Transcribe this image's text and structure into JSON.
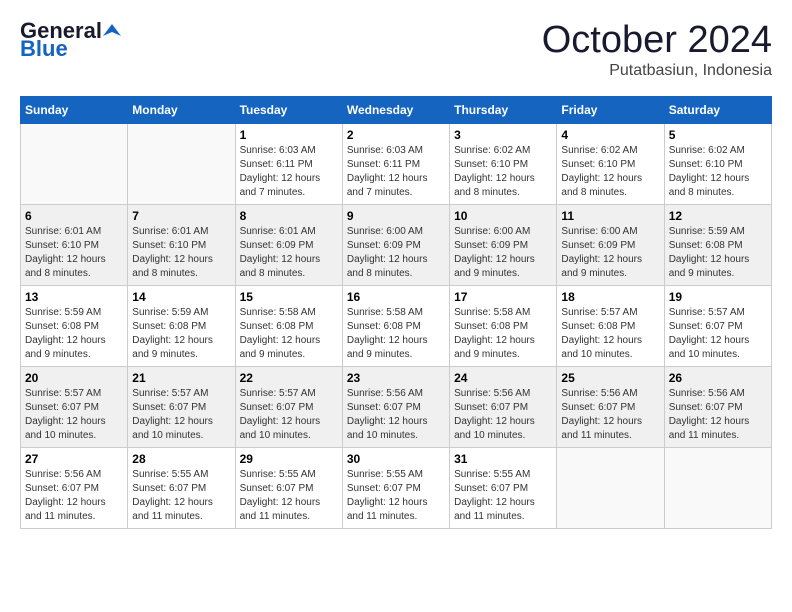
{
  "header": {
    "logo_general": "General",
    "logo_blue": "Blue",
    "month_title": "October 2024",
    "location": "Putatbasiun, Indonesia"
  },
  "weekdays": [
    "Sunday",
    "Monday",
    "Tuesday",
    "Wednesday",
    "Thursday",
    "Friday",
    "Saturday"
  ],
  "weeks": [
    [
      {
        "day": "",
        "info": ""
      },
      {
        "day": "",
        "info": ""
      },
      {
        "day": "1",
        "info": "Sunrise: 6:03 AM\nSunset: 6:11 PM\nDaylight: 12 hours and 7 minutes."
      },
      {
        "day": "2",
        "info": "Sunrise: 6:03 AM\nSunset: 6:11 PM\nDaylight: 12 hours and 7 minutes."
      },
      {
        "day": "3",
        "info": "Sunrise: 6:02 AM\nSunset: 6:10 PM\nDaylight: 12 hours and 8 minutes."
      },
      {
        "day": "4",
        "info": "Sunrise: 6:02 AM\nSunset: 6:10 PM\nDaylight: 12 hours and 8 minutes."
      },
      {
        "day": "5",
        "info": "Sunrise: 6:02 AM\nSunset: 6:10 PM\nDaylight: 12 hours and 8 minutes."
      }
    ],
    [
      {
        "day": "6",
        "info": "Sunrise: 6:01 AM\nSunset: 6:10 PM\nDaylight: 12 hours and 8 minutes."
      },
      {
        "day": "7",
        "info": "Sunrise: 6:01 AM\nSunset: 6:10 PM\nDaylight: 12 hours and 8 minutes."
      },
      {
        "day": "8",
        "info": "Sunrise: 6:01 AM\nSunset: 6:09 PM\nDaylight: 12 hours and 8 minutes."
      },
      {
        "day": "9",
        "info": "Sunrise: 6:00 AM\nSunset: 6:09 PM\nDaylight: 12 hours and 8 minutes."
      },
      {
        "day": "10",
        "info": "Sunrise: 6:00 AM\nSunset: 6:09 PM\nDaylight: 12 hours and 9 minutes."
      },
      {
        "day": "11",
        "info": "Sunrise: 6:00 AM\nSunset: 6:09 PM\nDaylight: 12 hours and 9 minutes."
      },
      {
        "day": "12",
        "info": "Sunrise: 5:59 AM\nSunset: 6:08 PM\nDaylight: 12 hours and 9 minutes."
      }
    ],
    [
      {
        "day": "13",
        "info": "Sunrise: 5:59 AM\nSunset: 6:08 PM\nDaylight: 12 hours and 9 minutes."
      },
      {
        "day": "14",
        "info": "Sunrise: 5:59 AM\nSunset: 6:08 PM\nDaylight: 12 hours and 9 minutes."
      },
      {
        "day": "15",
        "info": "Sunrise: 5:58 AM\nSunset: 6:08 PM\nDaylight: 12 hours and 9 minutes."
      },
      {
        "day": "16",
        "info": "Sunrise: 5:58 AM\nSunset: 6:08 PM\nDaylight: 12 hours and 9 minutes."
      },
      {
        "day": "17",
        "info": "Sunrise: 5:58 AM\nSunset: 6:08 PM\nDaylight: 12 hours and 9 minutes."
      },
      {
        "day": "18",
        "info": "Sunrise: 5:57 AM\nSunset: 6:08 PM\nDaylight: 12 hours and 10 minutes."
      },
      {
        "day": "19",
        "info": "Sunrise: 5:57 AM\nSunset: 6:07 PM\nDaylight: 12 hours and 10 minutes."
      }
    ],
    [
      {
        "day": "20",
        "info": "Sunrise: 5:57 AM\nSunset: 6:07 PM\nDaylight: 12 hours and 10 minutes."
      },
      {
        "day": "21",
        "info": "Sunrise: 5:57 AM\nSunset: 6:07 PM\nDaylight: 12 hours and 10 minutes."
      },
      {
        "day": "22",
        "info": "Sunrise: 5:57 AM\nSunset: 6:07 PM\nDaylight: 12 hours and 10 minutes."
      },
      {
        "day": "23",
        "info": "Sunrise: 5:56 AM\nSunset: 6:07 PM\nDaylight: 12 hours and 10 minutes."
      },
      {
        "day": "24",
        "info": "Sunrise: 5:56 AM\nSunset: 6:07 PM\nDaylight: 12 hours and 10 minutes."
      },
      {
        "day": "25",
        "info": "Sunrise: 5:56 AM\nSunset: 6:07 PM\nDaylight: 12 hours and 11 minutes."
      },
      {
        "day": "26",
        "info": "Sunrise: 5:56 AM\nSunset: 6:07 PM\nDaylight: 12 hours and 11 minutes."
      }
    ],
    [
      {
        "day": "27",
        "info": "Sunrise: 5:56 AM\nSunset: 6:07 PM\nDaylight: 12 hours and 11 minutes."
      },
      {
        "day": "28",
        "info": "Sunrise: 5:55 AM\nSunset: 6:07 PM\nDaylight: 12 hours and 11 minutes."
      },
      {
        "day": "29",
        "info": "Sunrise: 5:55 AM\nSunset: 6:07 PM\nDaylight: 12 hours and 11 minutes."
      },
      {
        "day": "30",
        "info": "Sunrise: 5:55 AM\nSunset: 6:07 PM\nDaylight: 12 hours and 11 minutes."
      },
      {
        "day": "31",
        "info": "Sunrise: 5:55 AM\nSunset: 6:07 PM\nDaylight: 12 hours and 11 minutes."
      },
      {
        "day": "",
        "info": ""
      },
      {
        "day": "",
        "info": ""
      }
    ]
  ]
}
